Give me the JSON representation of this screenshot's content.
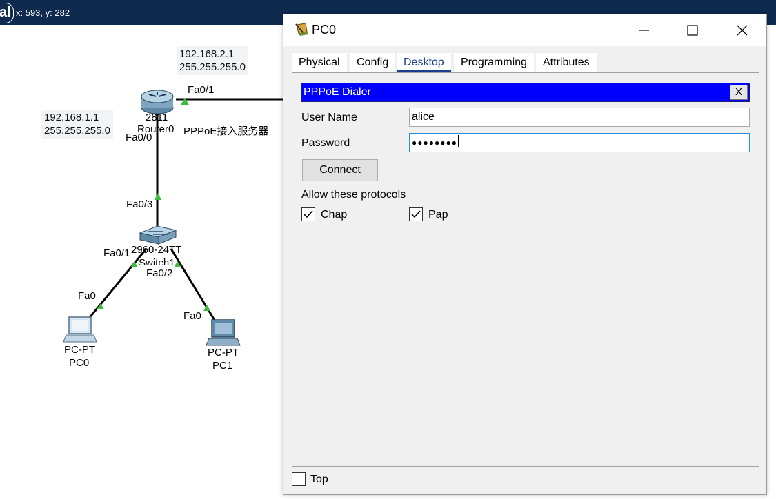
{
  "app": {
    "mode_label": "al",
    "coords_text": "x: 593, y: 282"
  },
  "topology": {
    "router": {
      "model": "2811",
      "name": "Router0",
      "note": "PPPoE接入服务器",
      "wan_ip": "192.168.2.1",
      "wan_mask": "255.255.255.0",
      "lan_ip": "192.168.1.1",
      "lan_mask": "255.255.255.0",
      "port_wan": "Fa0/1",
      "port_lan": "Fa0/0"
    },
    "switch": {
      "model": "2960-24TT",
      "name": "Switch1",
      "port_uplink": "Fa0/3",
      "port_pc0": "Fa0/1",
      "port_pc1": "Fa0/2"
    },
    "pcs": [
      {
        "type": "PC-PT",
        "name": "PC0",
        "port": "Fa0"
      },
      {
        "type": "PC-PT",
        "name": "PC1",
        "port": "Fa0"
      }
    ],
    "link_color": "#000000",
    "port_up_color": "#3dbb3d"
  },
  "window": {
    "title": "PC0",
    "minimize_icon": "minimize-icon",
    "maximize_icon": "maximize-icon",
    "close_icon": "close-icon",
    "tabs": [
      {
        "label": "Physical",
        "active": false
      },
      {
        "label": "Config",
        "active": false
      },
      {
        "label": "Desktop",
        "active": true
      },
      {
        "label": "Programming",
        "active": false
      },
      {
        "label": "Attributes",
        "active": false
      }
    ],
    "dialer": {
      "title": "PPPoE Dialer",
      "close_label": "X",
      "username_label": "User Name",
      "username_value": "alice",
      "password_label": "Password",
      "password_value": "●●●●●●●●",
      "connect_label": "Connect",
      "protocols_label": "Allow these protocols",
      "protocols": [
        {
          "label": "Chap",
          "checked": true
        },
        {
          "label": "Pap",
          "checked": true
        }
      ],
      "bar_color": "#0000ff"
    },
    "top_label": "Top",
    "top_checked": false
  }
}
